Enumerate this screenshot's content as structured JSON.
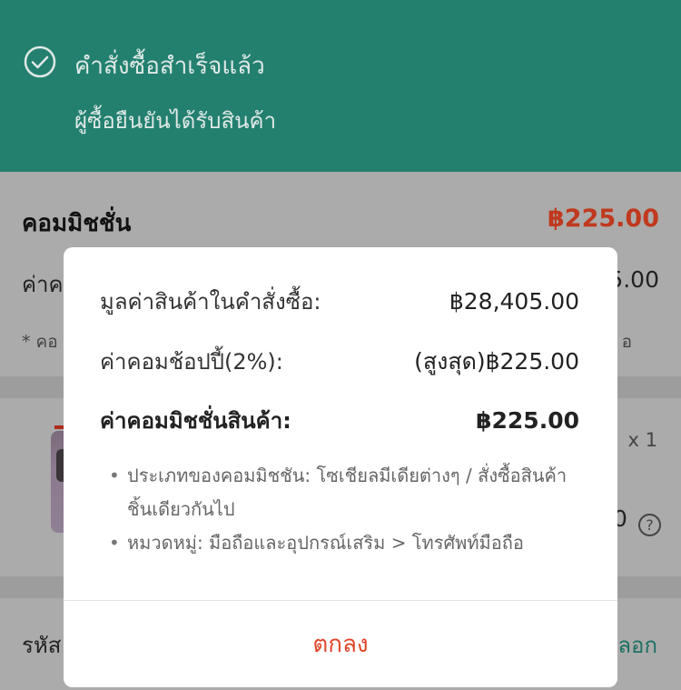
{
  "status_banner": {
    "title": "คำสั่งซื้อสำเร็จแล้ว",
    "subtitle": "ผู้ซื้อยืนยันได้รับสินค้า"
  },
  "commission_section": {
    "title": "คอมมิชชั่น",
    "amount": "฿225.00",
    "row_label_fragment": "ค่าค",
    "row_value_fragment": "5.00",
    "note_fragment": "* คอ",
    "note_end_fragment": "อ"
  },
  "product_section": {
    "quantity": "x 1",
    "price_fragment": "0",
    "help_icon": "?"
  },
  "order_section": {
    "label_fragment": "รหัส",
    "copy_fragment": "ลอก"
  },
  "modal": {
    "rows": [
      {
        "label": "มูลค่าสินค้าในคำสั่งซื้อ:",
        "value": "฿28,405.00"
      },
      {
        "label": "ค่าคอมช้อปปี้(2%):",
        "value": "(สูงสุด)฿225.00"
      },
      {
        "label": "ค่าคอมมิชชั่นสินค้า:",
        "value": "฿225.00"
      }
    ],
    "bullets": [
      "ประเภทของคอมมิชชัน: โซเชียลมีเดียต่างๆ / สั่งซื้อสินค้าชิ้นเดียวกันไป",
      "หมวดหมู่: มือถือและอุปกรณ์เสริม > โทรศัพท์มือถือ"
    ],
    "ok_label": "ตกลง"
  },
  "colors": {
    "banner": "#23806f",
    "accent_red": "#e0452a",
    "amount_red": "#c0391e",
    "link_teal": "#1d6f63"
  },
  "icons": [
    "check-circle-icon",
    "help-icon"
  ]
}
